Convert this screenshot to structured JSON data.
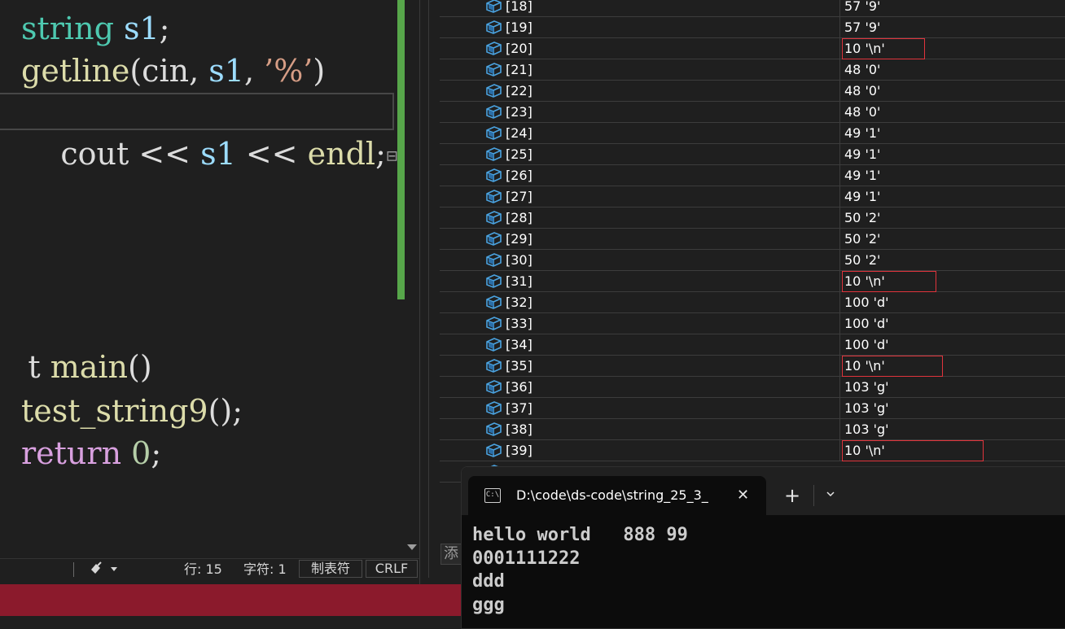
{
  "editor": {
    "lines": [
      {
        "tokens": [
          {
            "t": "string",
            "c": "#4ec9b0"
          },
          {
            "t": " ",
            "c": "#dcdcdc"
          },
          {
            "t": "s1",
            "c": "#9cdcfe"
          },
          {
            "t": ";",
            "c": "#dcdcdc"
          }
        ]
      },
      {
        "tokens": [
          {
            "t": "getline",
            "c": "#dcdcaa"
          },
          {
            "t": "(cin, ",
            "c": "#dcdcdc"
          },
          {
            "t": "s1",
            "c": "#9cdcfe"
          },
          {
            "t": ", ",
            "c": "#dcdcdc"
          },
          {
            "t": "’%’",
            "c": "#d69d85"
          },
          {
            "t": ")",
            "c": "#dcdcdc"
          }
        ]
      },
      {
        "tokens": [
          {
            "t": "cout",
            "c": "#dcdcdc"
          },
          {
            "t": " << ",
            "c": "#dcdcdc"
          },
          {
            "t": "s1",
            "c": "#9cdcfe"
          },
          {
            "t": " << ",
            "c": "#dcdcdc"
          },
          {
            "t": "endl",
            "c": "#dcdcaa"
          },
          {
            "t": ";",
            "c": "#dcdcdc"
          }
        ]
      },
      {
        "tokens": [
          {
            "t": "main",
            "c": "#dcdcaa"
          },
          {
            "t": "()",
            "c": "#dcdcdc"
          }
        ]
      },
      {
        "tokens": [
          {
            "t": "test_string9",
            "c": "#dcdcaa"
          },
          {
            "t": "();",
            "c": "#dcdcdc"
          }
        ]
      },
      {
        "tokens": [
          {
            "t": "return",
            "c": "#d8a0df"
          },
          {
            "t": " ",
            "c": "#dcdcdc"
          },
          {
            "t": "0",
            "c": "#b5cea8"
          },
          {
            "t": ";",
            "c": "#dcdcdc"
          }
        ]
      }
    ],
    "fold_glyph": "⊟",
    "main_prefix": "t",
    "status": {
      "brush_icon": "cleanup-brush-icon",
      "line": "行: 15",
      "char": "字符: 1",
      "tabs": "制表符",
      "eol": "CRLF"
    }
  },
  "watch": {
    "rows": [
      {
        "name": "[18]",
        "value": "57 '9'"
      },
      {
        "name": "[19]",
        "value": "57 '9'"
      },
      {
        "name": "[20]",
        "value": "10 '\\n'"
      },
      {
        "name": "[21]",
        "value": "48 '0'"
      },
      {
        "name": "[22]",
        "value": "48 '0'"
      },
      {
        "name": "[23]",
        "value": "48 '0'"
      },
      {
        "name": "[24]",
        "value": "49 '1'"
      },
      {
        "name": "[25]",
        "value": "49 '1'"
      },
      {
        "name": "[26]",
        "value": "49 '1'"
      },
      {
        "name": "[27]",
        "value": "49 '1'"
      },
      {
        "name": "[28]",
        "value": "50 '2'"
      },
      {
        "name": "[29]",
        "value": "50 '2'"
      },
      {
        "name": "[30]",
        "value": "50 '2'"
      },
      {
        "name": "[31]",
        "value": "10 '\\n'"
      },
      {
        "name": "[32]",
        "value": "100 'd'"
      },
      {
        "name": "[33]",
        "value": "100 'd'"
      },
      {
        "name": "[34]",
        "value": "100 'd'"
      },
      {
        "name": "[35]",
        "value": "10 '\\n'"
      },
      {
        "name": "[36]",
        "value": "103 'g'"
      },
      {
        "name": "[37]",
        "value": "103 'g'"
      },
      {
        "name": "[38]",
        "value": "103 'g'"
      },
      {
        "name": "[39]",
        "value": "10 '\\n'"
      }
    ],
    "add_placeholder": "添",
    "icon": "member-cube-icon",
    "highlight_color": "#e0343c"
  },
  "terminal": {
    "tab_title": "D:\\code\\ds-code\\string_25_3_",
    "close_glyph": "✕",
    "plus_glyph": "+",
    "cmd_icon_text": "C:\\",
    "output": [
      "hello world   888 99",
      "0001111222",
      "ddd",
      "ggg"
    ]
  }
}
